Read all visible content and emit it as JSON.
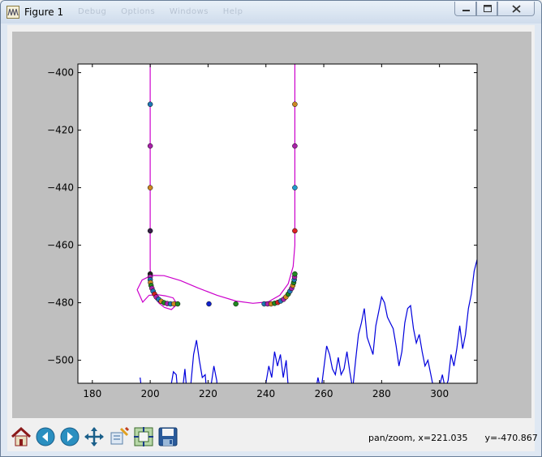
{
  "window": {
    "title": "Figure 1",
    "menu_hint": [
      "Debug",
      "Options",
      "Windows",
      "Help"
    ]
  },
  "toolbar": {
    "buttons": [
      "home-icon",
      "back-icon",
      "forward-icon",
      "pan-icon",
      "zoom-icon",
      "subplots-icon",
      "save-icon"
    ]
  },
  "status": {
    "text": "pan/zoom, x=221.035      y=-470.867"
  },
  "colors": {
    "canvas_bg": "#bfbfbf",
    "axes_bg": "#ffffff",
    "path_line": "#cc00cc",
    "noise_line": "#0000dd"
  },
  "chart_data": {
    "type": "line",
    "xlim": [
      175,
      313
    ],
    "ylim": [
      -508,
      -397
    ],
    "xticks": [
      180,
      200,
      220,
      240,
      260,
      280,
      300
    ],
    "yticks": [
      -400,
      -420,
      -440,
      -460,
      -480,
      -500
    ],
    "title": "",
    "xlabel": "",
    "ylabel": "",
    "grid": false,
    "series": [
      {
        "kind": "line",
        "color": "#cc00cc",
        "x": [
          200,
          200,
          200,
          200,
          200,
          200,
          200,
          200,
          200,
          200.2,
          200.8,
          201.8,
          203.1,
          204.9,
          207.3,
          209.3,
          207.9,
          205.2,
          202.5,
          199.6,
          197.4,
          195.5,
          197.2,
          200.4,
          204.8,
          210.5,
          216.4,
          223.1,
          229.6,
          235.5,
          240.8,
          244.8,
          247.7,
          249.4,
          250,
          250,
          250,
          250,
          250,
          250,
          250,
          250,
          250,
          250
        ],
        "y": [
          -396,
          -405,
          -415,
          -425,
          -435,
          -445,
          -455,
          -462,
          -468,
          -473,
          -476,
          -478.6,
          -480.2,
          -481.6,
          -482.4,
          -480.5,
          -478.3,
          -477.6,
          -477.2,
          -477.4,
          -479.8,
          -475.5,
          -472.1,
          -470.5,
          -470.6,
          -472.3,
          -474.8,
          -477.4,
          -479.4,
          -480.2,
          -479.7,
          -477.4,
          -473.4,
          -467.4,
          -460,
          -450,
          -440,
          -430,
          -420,
          -410,
          -405,
          -400,
          -397,
          -396
        ]
      },
      {
        "kind": "line",
        "color": "#0000dd",
        "x": [
          196.5,
          197,
          198,
          199,
          200,
          201,
          202,
          203,
          204,
          205,
          206,
          207,
          208,
          209,
          210,
          211,
          212,
          213,
          214,
          215,
          216,
          217,
          218,
          219,
          220,
          221,
          222,
          223,
          224,
          225,
          226,
          227,
          228,
          229,
          230,
          231,
          232,
          233,
          234,
          235,
          236,
          237,
          238,
          239,
          240,
          241,
          242,
          243,
          244,
          245,
          246,
          247,
          248,
          249,
          250,
          251,
          252,
          253,
          254,
          255,
          256,
          257,
          258,
          259,
          260,
          261,
          262,
          263,
          264,
          265,
          266,
          267,
          268,
          269,
          270,
          271,
          272,
          273,
          274,
          275,
          276,
          277,
          278,
          279,
          280,
          281,
          282,
          283,
          284,
          285,
          286,
          287,
          288,
          289,
          290,
          291,
          292,
          293,
          294,
          295,
          296,
          297,
          298,
          299,
          300,
          301,
          302,
          303,
          304,
          305,
          306,
          307,
          308,
          309,
          310,
          311,
          312,
          313
        ],
        "x_note": "",
        "y": [
          -506,
          -510,
          -515,
          -522,
          -527,
          -533,
          -522,
          -515,
          -528,
          -521,
          -519,
          -510,
          -504,
          -505,
          -517,
          -512,
          -503,
          -515,
          -509,
          -498,
          -493,
          -500,
          -506,
          -505,
          -516,
          -509,
          -502,
          -507,
          -522,
          -515,
          -530,
          -526,
          -538,
          -522,
          -517,
          -527,
          -525,
          -520,
          -532,
          -520,
          -528,
          -517,
          -521,
          -511,
          -508,
          -502,
          -506,
          -497,
          -502,
          -498,
          -506,
          -500,
          -513,
          -519,
          -518,
          -510,
          -509,
          -521,
          -530,
          -524,
          -520,
          -512,
          -506,
          -511,
          -503,
          -495,
          -498,
          -503,
          -505,
          -499,
          -505,
          -503,
          -497,
          -504,
          -510,
          -500,
          -491,
          -487,
          -482,
          -492,
          -495,
          -498,
          -488,
          -483,
          -478,
          -480,
          -485,
          -487,
          -489,
          -495,
          -502,
          -497,
          -487,
          -482,
          -481,
          -489,
          -494,
          -491,
          -497,
          -502,
          -500,
          -505,
          -510,
          -513,
          -509,
          -505,
          -510,
          -507,
          -498,
          -502,
          -496,
          -488,
          -496,
          -491,
          -482,
          -477,
          -469,
          -465
        ]
      },
      {
        "kind": "scatter",
        "points": [
          {
            "x": 200,
            "y": -411,
            "color": "#1f77b4"
          },
          {
            "x": 200,
            "y": -425.5,
            "color": "#aa22aa"
          },
          {
            "x": 200,
            "y": -440,
            "color": "#cc8822"
          },
          {
            "x": 200,
            "y": -455,
            "color": "#332244"
          },
          {
            "x": 200,
            "y": -470,
            "color": "#222222"
          },
          {
            "x": 200,
            "y": -471,
            "color": "#aa22aa"
          },
          {
            "x": 200,
            "y": -472,
            "color": "#1f77b4"
          },
          {
            "x": 200.1,
            "y": -473,
            "color": "#cc8822"
          },
          {
            "x": 200.3,
            "y": -474,
            "color": "#228822"
          },
          {
            "x": 200.6,
            "y": -475,
            "color": "#aa22aa"
          },
          {
            "x": 201,
            "y": -476,
            "color": "#1f77b4"
          },
          {
            "x": 201.5,
            "y": -477,
            "color": "#cc2222"
          },
          {
            "x": 202.1,
            "y": -478,
            "color": "#aa22aa"
          },
          {
            "x": 202.9,
            "y": -478.8,
            "color": "#1f77b4"
          },
          {
            "x": 203.8,
            "y": -479.5,
            "color": "#cc8822"
          },
          {
            "x": 204.8,
            "y": -480,
            "color": "#228822"
          },
          {
            "x": 205.9,
            "y": -480.3,
            "color": "#aa22aa"
          },
          {
            "x": 207,
            "y": -480.4,
            "color": "#1f77b4"
          },
          {
            "x": 208.2,
            "y": -480.4,
            "color": "#cc8822"
          },
          {
            "x": 209.5,
            "y": -480.4,
            "color": "#228822"
          },
          {
            "x": 220.3,
            "y": -480.4,
            "color": "#1122cc"
          },
          {
            "x": 229.6,
            "y": -480.4,
            "color": "#228822"
          },
          {
            "x": 239.4,
            "y": -480.4,
            "color": "#1f77b4"
          },
          {
            "x": 240.6,
            "y": -480.4,
            "color": "#aa22aa"
          },
          {
            "x": 241.8,
            "y": -480.4,
            "color": "#cc8822"
          },
          {
            "x": 243,
            "y": -480.2,
            "color": "#228822"
          },
          {
            "x": 244.1,
            "y": -479.9,
            "color": "#cc2222"
          },
          {
            "x": 245.1,
            "y": -479.4,
            "color": "#1f77b4"
          },
          {
            "x": 246.1,
            "y": -478.8,
            "color": "#aa22aa"
          },
          {
            "x": 246.9,
            "y": -478,
            "color": "#cc8822"
          },
          {
            "x": 247.7,
            "y": -477,
            "color": "#228822"
          },
          {
            "x": 248.3,
            "y": -476,
            "color": "#1f77b4"
          },
          {
            "x": 248.9,
            "y": -475,
            "color": "#aa22aa"
          },
          {
            "x": 249.3,
            "y": -474,
            "color": "#cc8822"
          },
          {
            "x": 249.6,
            "y": -473,
            "color": "#228822"
          },
          {
            "x": 249.8,
            "y": -472,
            "color": "#1f77b4"
          },
          {
            "x": 249.9,
            "y": -471,
            "color": "#aa22aa"
          },
          {
            "x": 250,
            "y": -470,
            "color": "#228822"
          },
          {
            "x": 250,
            "y": -455,
            "color": "#dd2222"
          },
          {
            "x": 250,
            "y": -440,
            "color": "#2299cc"
          },
          {
            "x": 250,
            "y": -425.5,
            "color": "#aa22aa"
          },
          {
            "x": 250,
            "y": -411,
            "color": "#cc8822"
          }
        ]
      }
    ]
  }
}
